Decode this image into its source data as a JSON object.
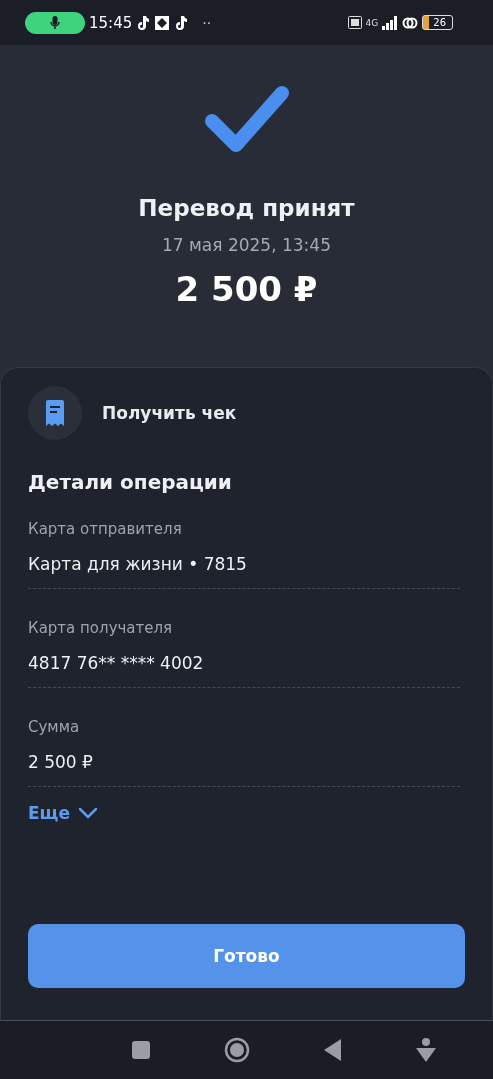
{
  "status_bar": {
    "time": "15:45",
    "more": "··",
    "network": "4G",
    "battery": "26"
  },
  "result": {
    "title": "Перевод принят",
    "date": "17 мая 2025, 13:45",
    "amount": "2 500 ₽"
  },
  "receipt": {
    "label": "Получить чек"
  },
  "details": {
    "title": "Детали операции",
    "fields": [
      {
        "label": "Карта отправителя",
        "value": "Карта для жизни • 7815"
      },
      {
        "label": "Карта получателя",
        "value": "4817 76** **** 4002"
      },
      {
        "label": "Сумма",
        "value": "2 500 ₽"
      }
    ],
    "more": {
      "label": "Еще",
      "expanded": false
    }
  },
  "done_button": "Готово"
}
